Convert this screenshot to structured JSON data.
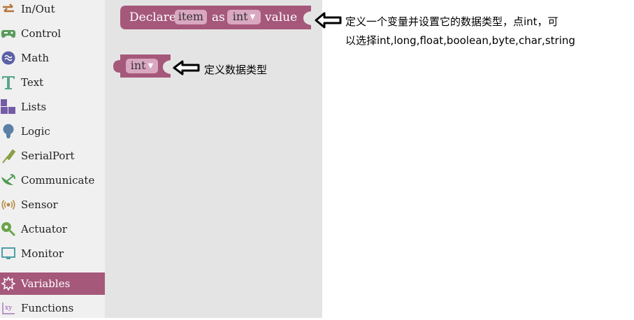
{
  "sidebar": {
    "items": [
      {
        "label": "In/Out",
        "icon": "arrows-icon"
      },
      {
        "label": "Control",
        "icon": "gamepad-icon"
      },
      {
        "label": "Math",
        "icon": "math-icon"
      },
      {
        "label": "Text",
        "icon": "text-icon"
      },
      {
        "label": "Lists",
        "icon": "lists-icon"
      },
      {
        "label": "Logic",
        "icon": "bulb-icon"
      },
      {
        "label": "SerialPort",
        "icon": "serial-icon"
      },
      {
        "label": "Communicate",
        "icon": "satellite-icon"
      },
      {
        "label": "Sensor",
        "icon": "sensor-icon"
      },
      {
        "label": "Actuator",
        "icon": "actuator-icon"
      },
      {
        "label": "Monitor",
        "icon": "monitor-icon"
      },
      {
        "label": "Variables",
        "icon": "variables-icon",
        "selected": true
      },
      {
        "label": "Functions",
        "icon": "functions-icon"
      }
    ]
  },
  "declare_block": {
    "declare": "Declare",
    "name": "item",
    "as": "as",
    "type": "int",
    "value": "value",
    "color": "#a5587a"
  },
  "type_block": {
    "type": "int",
    "color": "#a5587a"
  },
  "annotations": {
    "declare_line1": "定义一个变量并设置它的数据类型，点int，可",
    "declare_line2": "以选择int,long,float,boolean,byte,char,string",
    "type_note": "定义数据类型"
  },
  "colors": {
    "block": "#a5587a",
    "field": "#d9a8c0",
    "sidebar_bg": "#f0f0f0",
    "workspace_bg": "#e4e4e4"
  }
}
